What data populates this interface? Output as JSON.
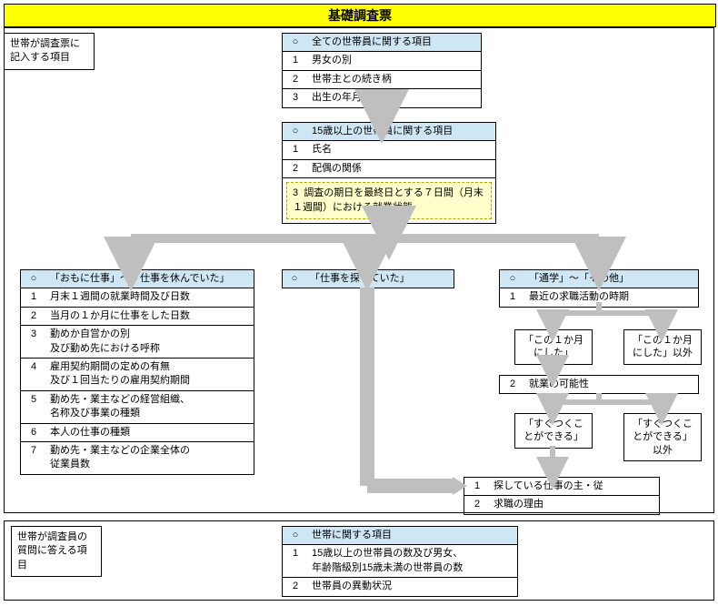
{
  "title": "基礎調査票",
  "section1": {
    "label": "世帯が調査票に記入する項目",
    "boxA": {
      "header": {
        "bullet": "○",
        "text": "全ての世帯員に関する項目"
      },
      "rows": [
        {
          "n": "1",
          "t": "男女の別"
        },
        {
          "n": "2",
          "t": "世帯主との続き柄"
        },
        {
          "n": "3",
          "t": "出生の年月"
        }
      ]
    },
    "boxB": {
      "header": {
        "bullet": "○",
        "text": "15歳以上の世帯員に関する項目"
      },
      "rows": [
        {
          "n": "1",
          "t": "氏名"
        },
        {
          "n": "2",
          "t": "配偶の関係"
        }
      ],
      "dashed": {
        "n": "3",
        "t": "調査の期日を最終日とする７日間（月末１週間）における就業状態"
      }
    },
    "boxC": {
      "header": {
        "bullet": "○",
        "text": "「おもに仕事」～「仕事を休んでいた」"
      },
      "rows": [
        {
          "n": "1",
          "t": "月末１週間の就業時間及び日数"
        },
        {
          "n": "2",
          "t": "当月の１か月に仕事をした日数"
        },
        {
          "n": "3",
          "t": "勤めか自営かの別\n及び勤め先における呼称"
        },
        {
          "n": "4",
          "t": "雇用契約期間の定めの有無\n及び１回当たりの雇用契約期間"
        },
        {
          "n": "5",
          "t": "勤め先・業主などの経営組織、\n名称及び事業の種類"
        },
        {
          "n": "6",
          "t": "本人の仕事の種類"
        },
        {
          "n": "7",
          "t": "勤め先・業主などの企業全体の\n従業員数"
        }
      ]
    },
    "boxD": {
      "header": {
        "bullet": "○",
        "text": "「仕事を探していた」"
      }
    },
    "boxE": {
      "header": {
        "bullet": "○",
        "text": "「通学」～「その他」"
      },
      "rows": [
        {
          "n": "1",
          "t": "最近の求職活動の時期"
        }
      ],
      "row2": {
        "n": "2",
        "t": "就業の可能性"
      },
      "opt1a": "「この１か月にした」",
      "opt1b": "「この１か月にした」以外",
      "opt2a": "「すぐつくことができる」",
      "opt2b": "「すぐつくことができる」以外"
    },
    "boxF": {
      "rows": [
        {
          "n": "1",
          "t": "探している仕事の主・従"
        },
        {
          "n": "2",
          "t": "求職の理由"
        }
      ]
    }
  },
  "section2": {
    "label": "世帯が調査員の質問に答える項目",
    "boxG": {
      "header": {
        "bullet": "○",
        "text": "世帯に関する項目"
      },
      "rows": [
        {
          "n": "1",
          "t": "15歳以上の世帯員の数及び男女、\n年齢階級別15歳未満の世帯員の数"
        },
        {
          "n": "2",
          "t": "世帯員の異動状況"
        }
      ]
    }
  }
}
